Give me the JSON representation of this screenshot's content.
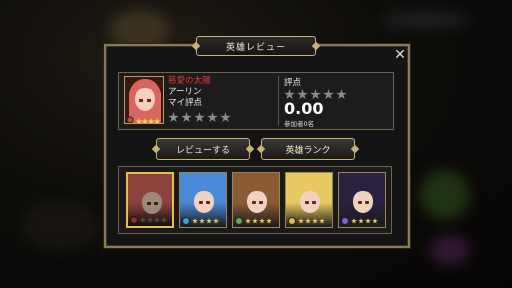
{
  "dialog": {
    "title": "英雄レビュー",
    "close_label": "✕"
  },
  "hero": {
    "epithet": "慈愛の太陽",
    "name": "アーリン",
    "my_rating_label": "マイ評点",
    "my_rating": 0,
    "portrait_hair": "#d9655f",
    "star_count": 4
  },
  "summary": {
    "rating_label": "評点",
    "score": "0.00",
    "participants": "参加者0名",
    "avg_rating": 0
  },
  "buttons": {
    "review": "レビューする",
    "rank": "英雄ランク"
  },
  "heroes": [
    {
      "hair": "#d9655f",
      "element_color": "#d04a3a",
      "stars": 4,
      "selected": true
    },
    {
      "hair": "#4a88d8",
      "element_color": "#3aa0d8",
      "stars": 4,
      "selected": false
    },
    {
      "hair": "#8a5a34",
      "element_color": "#5ab04a",
      "stars": 4,
      "selected": false
    },
    {
      "hair": "#e8c860",
      "element_color": "#e0c040",
      "stars": 4,
      "selected": false
    },
    {
      "hair": "#2a2040",
      "element_color": "#8a5ad8",
      "stars": 4,
      "selected": false
    }
  ],
  "colors": {
    "gold": "#c9b27a",
    "epithet_red": "#e03a3a"
  }
}
